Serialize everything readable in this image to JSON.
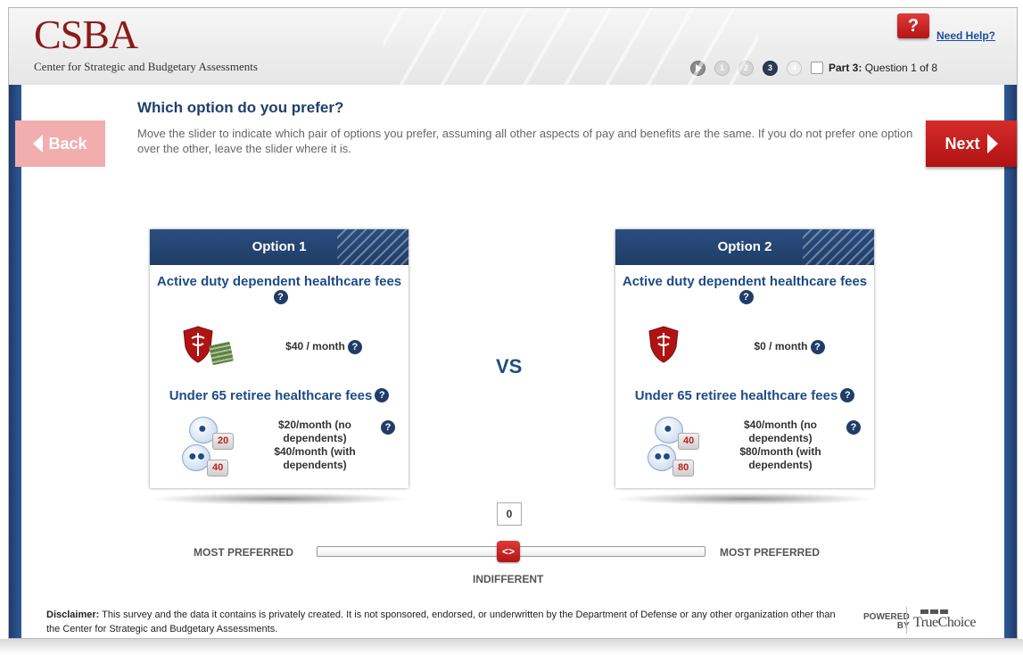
{
  "header": {
    "logo": "CSBA",
    "logo_subtitle": "Center for Strategic and Budgetary Assessments",
    "help_icon_glyph": "?",
    "help_link": "Need Help?",
    "progress": {
      "steps": [
        "1",
        "2",
        "3",
        "4"
      ],
      "current_step": "3",
      "part_label": "Part 3:",
      "question_label": "Question 1 of 8"
    }
  },
  "nav": {
    "back_label": "Back",
    "next_label": "Next"
  },
  "prompt": {
    "question": "Which option do you prefer?",
    "instructions": "Move the slider to indicate which pair of options you prefer, assuming all other aspects of pay and benefits are the same. If you do not prefer one option over the other, leave the slider where it is."
  },
  "vs_label": "VS",
  "options": [
    {
      "title": "Option 1",
      "attr1_title": "Active duty dependent healthcare fees",
      "attr1_value": "$40 / month",
      "attr2_title": "Under 65 retiree healthcare fees",
      "attr2_value": "$20/month (no dependents) $40/month (with dependents)",
      "tag_single": "20",
      "tag_family": "40"
    },
    {
      "title": "Option 2",
      "attr1_title": "Active duty dependent healthcare fees",
      "attr1_value": "$0 / month",
      "attr2_title": "Under 65 retiree healthcare fees",
      "attr2_value": "$40/month (no dependents) $80/month (with dependents)",
      "tag_single": "40",
      "tag_family": "80"
    }
  ],
  "slider": {
    "value": "0",
    "left_label": "MOST PREFERRED",
    "right_label": "MOST PREFERRED",
    "center_label": "INDIFFERENT",
    "handle_glyph": "<>"
  },
  "footer": {
    "disclaimer_label": "Disclaimer:",
    "disclaimer_text": "This survey and the data it contains is privately created. It is not sponsored, endorsed, or underwritten by the Department of Defense or any other organization other than the Center for Strategic and Budgetary Assessments.",
    "powered_line1": "POWERED",
    "powered_line2": "BY",
    "brand": "TrueChoice"
  },
  "colors": {
    "accent_red": "#c41e1e",
    "navy": "#1f3d68",
    "brand_maroon": "#8b1a1a"
  },
  "icons": [
    "help-icon",
    "back-arrow-icon",
    "next-arrow-icon",
    "question-mark-icon",
    "medical-shield-icon",
    "money-stack-icon",
    "single-person-icon",
    "family-icon",
    "slider-handle-icon"
  ]
}
